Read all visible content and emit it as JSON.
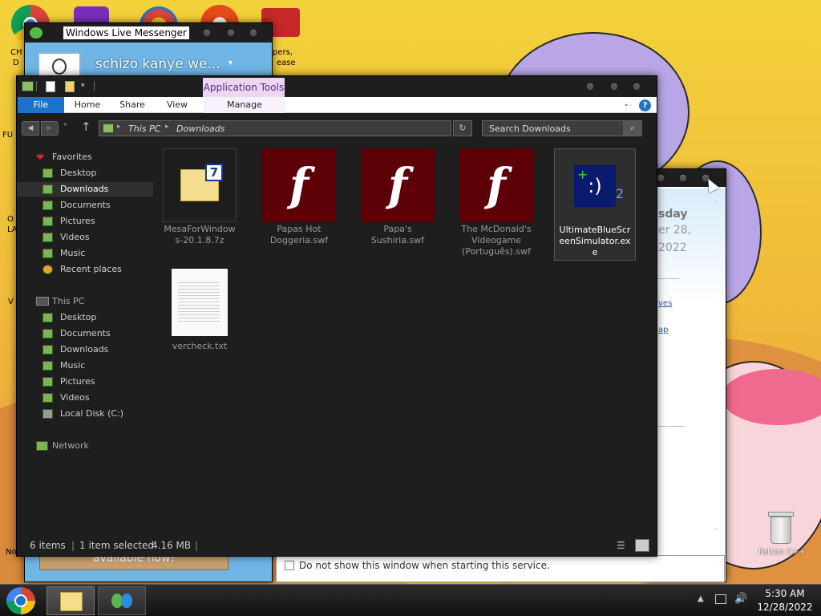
{
  "desktop": {
    "left_labels": [
      "CH",
      "D",
      "FU",
      "O",
      "LA",
      "V",
      "No"
    ],
    "top_right_label_1": "pers,",
    "top_right_label_2": "ease",
    "recycle_bin_label": "Falcon C++"
  },
  "messenger": {
    "title": "Windows Live Messenger",
    "username": "schizo kanye we...",
    "banner_text": "available now!"
  },
  "back_window": {
    "text_day": "sday",
    "text_date": "er 28,",
    "text_year": "2022",
    "link1": "ves",
    "link2": "ap",
    "checkbox_label": "Do not show this window when starting this service."
  },
  "explorer": {
    "context_tab": "Application Tools",
    "tabs": {
      "file": "File",
      "home": "Home",
      "share": "Share",
      "view": "View",
      "manage": "Manage"
    },
    "breadcrumb": {
      "root": "This PC",
      "current": "Downloads"
    },
    "search_placeholder": "Search Downloads",
    "nav": {
      "favorites": "Favorites",
      "fav_desktop": "Desktop",
      "fav_downloads": "Downloads",
      "fav_documents": "Documents",
      "fav_pictures": "Pictures",
      "fav_videos": "Videos",
      "fav_music": "Music",
      "fav_recent": "Recent places",
      "thispc": "This PC",
      "pc_desktop": "Desktop",
      "pc_documents": "Documents",
      "pc_downloads": "Downloads",
      "pc_music": "Music",
      "pc_pictures": "Pictures",
      "pc_videos": "Videos",
      "pc_localdisk": "Local Disk (C:)",
      "network": "Network"
    },
    "files": [
      {
        "name_line1": "MesaForWindow",
        "name_line2": "s-20.1.8.7z"
      },
      {
        "name_line1": "Papas Hot",
        "name_line2": "Doggeria.swf"
      },
      {
        "name_line1": "Papa's",
        "name_line2": "Sushiria.swf"
      },
      {
        "name_line1": "The McDonald's",
        "name_line2": "Videogame",
        "name_line3": "(Português).swf"
      },
      {
        "name_line1": "UltimateBlueScr",
        "name_line2": "eenSimulator.ex",
        "name_line3": "e"
      },
      {
        "name_line1": "vercheck.txt"
      }
    ],
    "status": {
      "count": "6 items",
      "selected": "1 item selected",
      "size": "4.16 MB"
    }
  },
  "taskbar": {
    "time": "5:30 AM",
    "date": "12/28/2022"
  },
  "colors": {
    "accent": "#1e73c8",
    "flash_bg": "#5d0008",
    "context_tab": "#e8c8f0"
  }
}
